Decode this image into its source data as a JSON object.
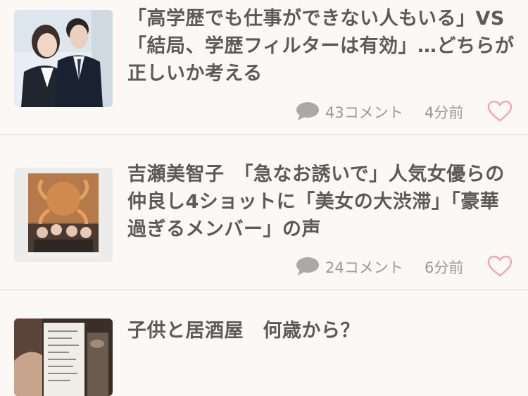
{
  "articles": [
    {
      "title": "「高学歴でも仕事ができない人もいる」VS「結局、学歴フィルターは有効」…どちらが正しいか考える",
      "comments": "43コメント",
      "time": "4分前"
    },
    {
      "title": "吉瀬美智子　「急なお誘いで」人気女優らの仲良し4ショットに「美女の大渋滞」「豪華過ぎるメンバー」の声",
      "comments": "24コメント",
      "time": "6分前"
    },
    {
      "title": "子供と居酒屋　何歳から？"
    }
  ],
  "icons": {
    "comment": "comment-bubble-icon",
    "favorite": "heart-outline-icon"
  },
  "colors": {
    "background": "#fcf8f5",
    "title": "#5a5a5a",
    "meta": "#9a9a9a",
    "heart": "#f0a6b2"
  }
}
